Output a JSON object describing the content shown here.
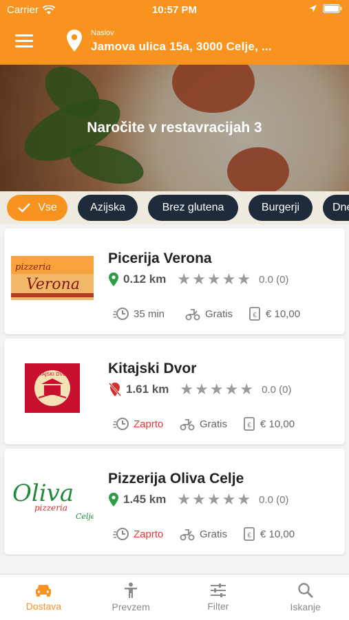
{
  "status_bar": {
    "carrier": "Carrier",
    "time": "10:57 PM"
  },
  "header": {
    "address_label": "Naslov",
    "address": "Jamova ulica 15a, 3000 Celje, ..."
  },
  "hero": {
    "title": "Naročite v restavracijah 3"
  },
  "chips": [
    {
      "label": "Vse",
      "active": true
    },
    {
      "label": "Azijska"
    },
    {
      "label": "Brez glutena"
    },
    {
      "label": "Burgerji"
    },
    {
      "label": "Dne"
    }
  ],
  "restaurants": [
    {
      "name": "Picerija Verona",
      "distance": "0.12 km",
      "rating": "0.0 (0)",
      "time": "35 min",
      "delivery": "Gratis",
      "min_order": "€ 10,00",
      "open": true,
      "logo_text": "pizzeria",
      "logo_text2": "Verona"
    },
    {
      "name": "Kitajski Dvor",
      "distance": "1.61 km",
      "rating": "0.0 (0)",
      "time": "Zaprto",
      "delivery": "Gratis",
      "min_order": "€ 10,00",
      "open": false,
      "logo_text": "KITAJSKI DVOR"
    },
    {
      "name": "Pizzerija Oliva Celje",
      "distance": "1.45 km",
      "rating": "0.0 (0)",
      "time": "Zaprto",
      "delivery": "Gratis",
      "min_order": "€ 10,00",
      "open": true,
      "logo_text": "Oliva",
      "logo_text2": "pizzeria",
      "logo_text3": "Celje"
    }
  ],
  "tabbar": {
    "items": [
      {
        "label": "Dostava"
      },
      {
        "label": "Prevzem"
      },
      {
        "label": "Filter"
      },
      {
        "label": "Iskanje"
      }
    ]
  },
  "colors": {
    "accent": "#f7931e",
    "chip_dark": "#1f2b3b",
    "closed": "#e53935",
    "pin_green": "#2e9e44",
    "pin_red": "#d32f2f"
  }
}
